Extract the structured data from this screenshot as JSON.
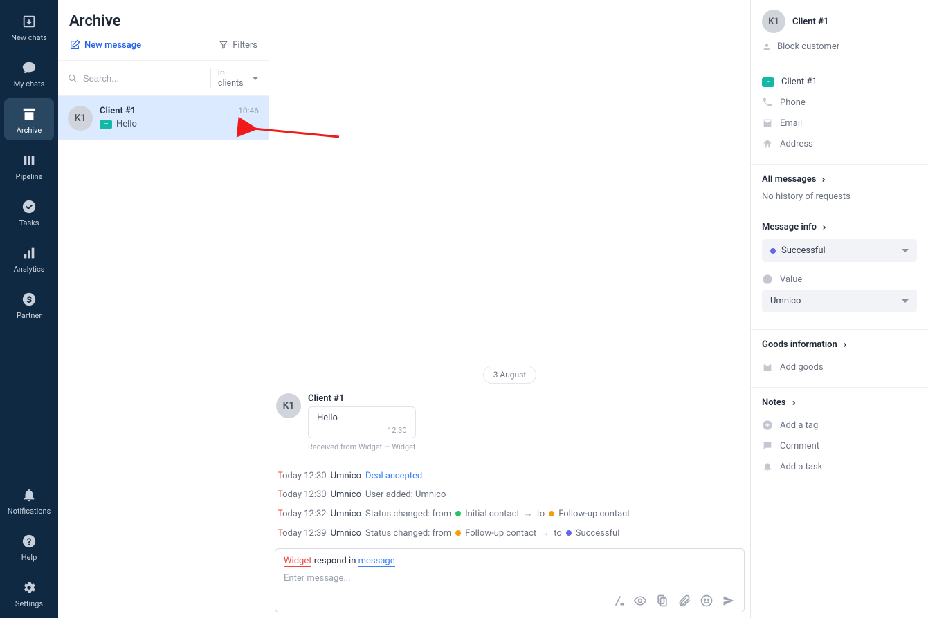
{
  "sidebar": {
    "items": [
      {
        "label": "New chats"
      },
      {
        "label": "My chats"
      },
      {
        "label": "Archive"
      },
      {
        "label": "Pipeline"
      },
      {
        "label": "Tasks"
      },
      {
        "label": "Analytics"
      },
      {
        "label": "Partner"
      }
    ],
    "footer": [
      {
        "label": "Notifications"
      },
      {
        "label": "Help"
      },
      {
        "label": "Settings"
      }
    ]
  },
  "list": {
    "title": "Archive",
    "new_message": "New message",
    "filters": "Filters",
    "search_placeholder": "Search...",
    "scope": "in clients",
    "chat": {
      "avatar": "K1",
      "name": "Client #1",
      "time": "10:46",
      "preview": "Hello"
    }
  },
  "conversation": {
    "date": "3 August",
    "sender_avatar": "K1",
    "sender_name": "Client #1",
    "message_text": "Hello",
    "message_time": "12:30",
    "received_meta": "Received from Widget — Widget",
    "activity": [
      {
        "time": "Today 12:30",
        "user": "Umnico",
        "text": "Deal accepted",
        "link": true
      },
      {
        "time": "Today 12:30",
        "user": "Umnico",
        "text": "User added: Umnico"
      },
      {
        "time": "Today 12:32",
        "user": "Umnico",
        "prefix": "Status changed: from",
        "from_dot": "green",
        "from_label": "Initial contact",
        "to_dot": "orange",
        "to_label": "Follow-up contact"
      },
      {
        "time": "Today 12:39",
        "user": "Umnico",
        "prefix": "Status changed: from",
        "from_dot": "orange",
        "from_label": "Follow-up contact",
        "to_dot": "blue",
        "to_label": "Successful"
      }
    ],
    "composer": {
      "hint_widget": "Widget",
      "hint_respond": " respond in ",
      "hint_message": "message",
      "placeholder": "Enter message..."
    }
  },
  "details": {
    "customer": {
      "avatar": "K1",
      "name": "Client #1",
      "block": "Block customer"
    },
    "contact": {
      "client": "Client #1",
      "phone": "Phone",
      "email": "Email",
      "address": "Address"
    },
    "all_messages": {
      "title": "All messages",
      "history": "No history of requests"
    },
    "message_info": {
      "title": "Message info",
      "status": "Successful",
      "value": "Value",
      "source": "Umnico"
    },
    "goods": {
      "title": "Goods information",
      "add": "Add goods"
    },
    "notes": {
      "title": "Notes",
      "tag": "Add a tag",
      "comment": "Comment",
      "task": "Add a task"
    }
  }
}
